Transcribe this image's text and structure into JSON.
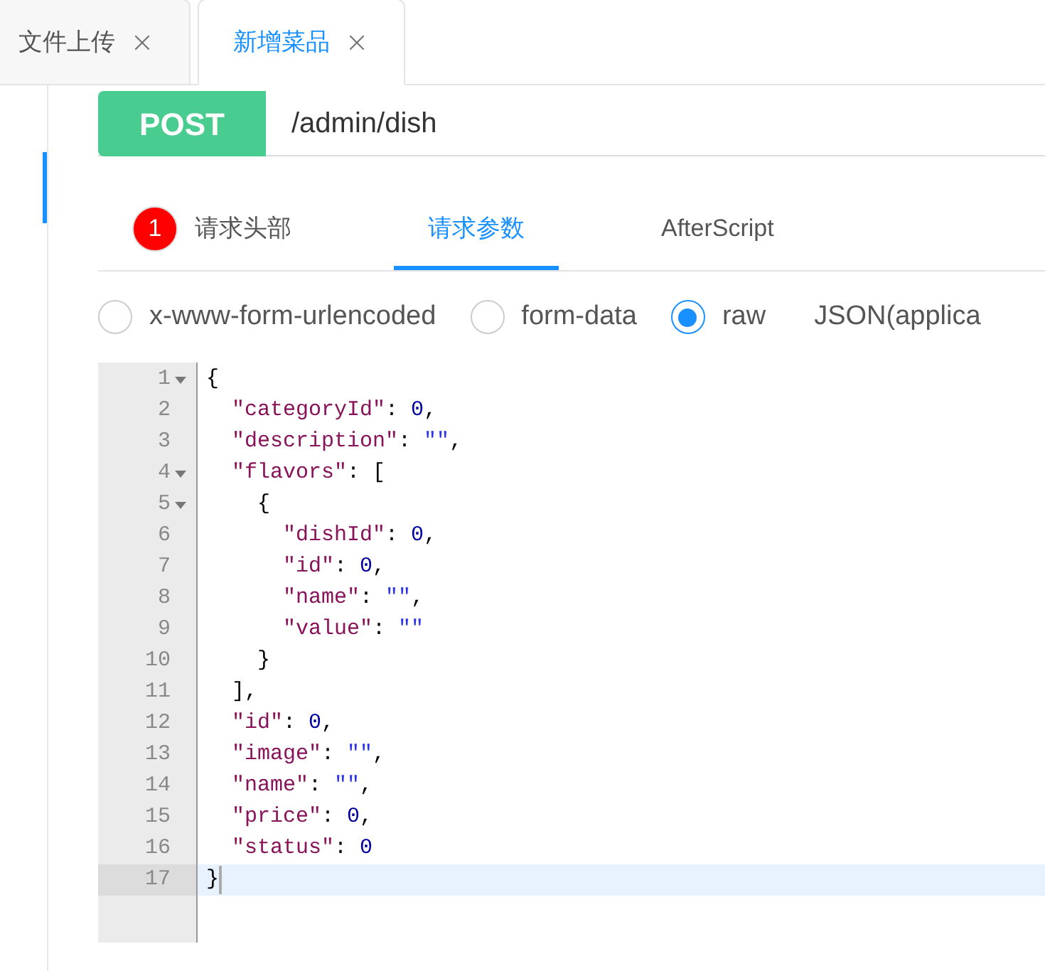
{
  "tabs": [
    {
      "label": "文件上传",
      "selected": false
    },
    {
      "label": "新增菜品",
      "selected": true
    }
  ],
  "request": {
    "method": "POST",
    "url": "/admin/dish"
  },
  "param_tabs": [
    {
      "label": "请求头部",
      "badge": "1",
      "selected": false
    },
    {
      "label": "请求参数",
      "selected": true
    },
    {
      "label": "AfterScript",
      "selected": false
    }
  ],
  "body_types": [
    {
      "label": "x-www-form-urlencoded",
      "selected": false
    },
    {
      "label": "form-data",
      "selected": false
    },
    {
      "label": "raw",
      "selected": true
    }
  ],
  "raw_format": "JSON(applica",
  "editor": {
    "lines": [
      {
        "number": "1",
        "foldable": true,
        "active": false,
        "tokens": [
          {
            "kind": "punct",
            "text": "{"
          }
        ]
      },
      {
        "number": "2",
        "foldable": false,
        "active": false,
        "tokens": [
          {
            "kind": "key",
            "text": "  \"categoryId\""
          },
          {
            "kind": "punct",
            "text": ": "
          },
          {
            "kind": "number",
            "text": "0"
          },
          {
            "kind": "punct",
            "text": ","
          }
        ]
      },
      {
        "number": "3",
        "foldable": false,
        "active": false,
        "tokens": [
          {
            "kind": "key",
            "text": "  \"description\""
          },
          {
            "kind": "punct",
            "text": ": "
          },
          {
            "kind": "string",
            "text": "\"\""
          },
          {
            "kind": "punct",
            "text": ","
          }
        ]
      },
      {
        "number": "4",
        "foldable": true,
        "active": false,
        "tokens": [
          {
            "kind": "key",
            "text": "  \"flavors\""
          },
          {
            "kind": "punct",
            "text": ": ["
          }
        ]
      },
      {
        "number": "5",
        "foldable": true,
        "active": false,
        "tokens": [
          {
            "kind": "punct",
            "text": "    {"
          }
        ]
      },
      {
        "number": "6",
        "foldable": false,
        "active": false,
        "tokens": [
          {
            "kind": "key",
            "text": "      \"dishId\""
          },
          {
            "kind": "punct",
            "text": ": "
          },
          {
            "kind": "number",
            "text": "0"
          },
          {
            "kind": "punct",
            "text": ","
          }
        ]
      },
      {
        "number": "7",
        "foldable": false,
        "active": false,
        "tokens": [
          {
            "kind": "key",
            "text": "      \"id\""
          },
          {
            "kind": "punct",
            "text": ": "
          },
          {
            "kind": "number",
            "text": "0"
          },
          {
            "kind": "punct",
            "text": ","
          }
        ]
      },
      {
        "number": "8",
        "foldable": false,
        "active": false,
        "tokens": [
          {
            "kind": "key",
            "text": "      \"name\""
          },
          {
            "kind": "punct",
            "text": ": "
          },
          {
            "kind": "string",
            "text": "\"\""
          },
          {
            "kind": "punct",
            "text": ","
          }
        ]
      },
      {
        "number": "9",
        "foldable": false,
        "active": false,
        "tokens": [
          {
            "kind": "key",
            "text": "      \"value\""
          },
          {
            "kind": "punct",
            "text": ": "
          },
          {
            "kind": "string",
            "text": "\"\""
          }
        ]
      },
      {
        "number": "10",
        "foldable": false,
        "active": false,
        "tokens": [
          {
            "kind": "punct",
            "text": "    }"
          }
        ]
      },
      {
        "number": "11",
        "foldable": false,
        "active": false,
        "tokens": [
          {
            "kind": "punct",
            "text": "  ],"
          }
        ]
      },
      {
        "number": "12",
        "foldable": false,
        "active": false,
        "tokens": [
          {
            "kind": "key",
            "text": "  \"id\""
          },
          {
            "kind": "punct",
            "text": ": "
          },
          {
            "kind": "number",
            "text": "0"
          },
          {
            "kind": "punct",
            "text": ","
          }
        ]
      },
      {
        "number": "13",
        "foldable": false,
        "active": false,
        "tokens": [
          {
            "kind": "key",
            "text": "  \"image\""
          },
          {
            "kind": "punct",
            "text": ": "
          },
          {
            "kind": "string",
            "text": "\"\""
          },
          {
            "kind": "punct",
            "text": ","
          }
        ]
      },
      {
        "number": "14",
        "foldable": false,
        "active": false,
        "tokens": [
          {
            "kind": "key",
            "text": "  \"name\""
          },
          {
            "kind": "punct",
            "text": ": "
          },
          {
            "kind": "string",
            "text": "\"\""
          },
          {
            "kind": "punct",
            "text": ","
          }
        ]
      },
      {
        "number": "15",
        "foldable": false,
        "active": false,
        "tokens": [
          {
            "kind": "key",
            "text": "  \"price\""
          },
          {
            "kind": "punct",
            "text": ": "
          },
          {
            "kind": "number",
            "text": "0"
          },
          {
            "kind": "punct",
            "text": ","
          }
        ]
      },
      {
        "number": "16",
        "foldable": false,
        "active": false,
        "tokens": [
          {
            "kind": "key",
            "text": "  \"status\""
          },
          {
            "kind": "punct",
            "text": ": "
          },
          {
            "kind": "number",
            "text": "0"
          }
        ]
      },
      {
        "number": "17",
        "foldable": false,
        "active": true,
        "tokens": [
          {
            "kind": "punct",
            "text": "}"
          }
        ]
      }
    ]
  }
}
